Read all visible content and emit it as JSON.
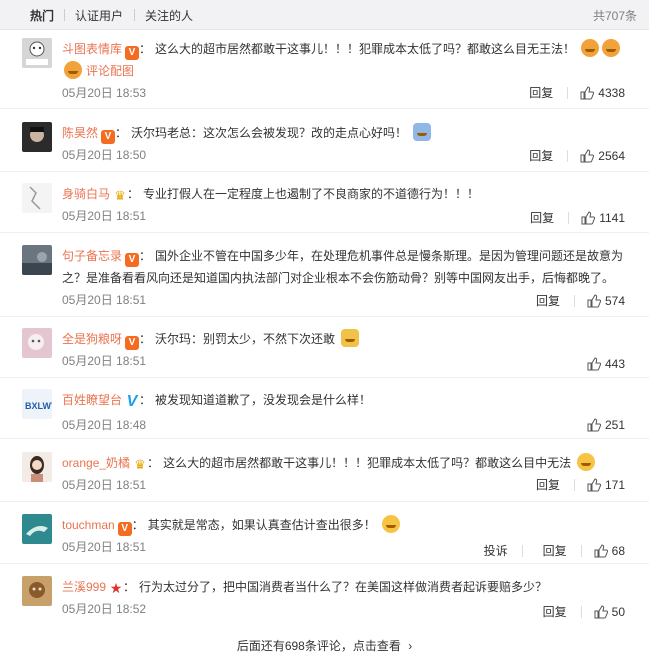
{
  "tabs": {
    "hot": "热门",
    "verified": "认证用户",
    "following": "关注的人",
    "total": "共707条"
  },
  "reply_label": "回复",
  "report_label": "投诉",
  "comments": [
    {
      "user": "斗图表情库",
      "badge": "V",
      "text": "这么大的超市居然都敢干这事儿！！！犯罪成本太低了吗？都敢这么目无王法！",
      "extra": "评论配图",
      "time": "05月20日 18:53",
      "likes": "4338",
      "avatar_color": "#bbbbbb"
    },
    {
      "user": "陈昊然",
      "badge": "V",
      "text": "沃尔玛老总：这次怎么会被发现？改的走点心好吗！",
      "time": "05月20日 18:50",
      "likes": "2564",
      "avatar_color": "#2b2b2b"
    },
    {
      "user": "身骑白马",
      "badge": "crown",
      "text": "专业打假人在一定程度上也遏制了不良商家的不道德行为！！！",
      "time": "05月20日 18:51",
      "likes": "1141",
      "avatar_color": "#e9e9e9"
    },
    {
      "user": "句子备忘录",
      "badge": "V",
      "text": "国外企业不管在中国多少年，在处理危机事件总是慢条斯理。是因为管理问题还是故意为之？是准备看看风向还是知道国内执法部门对企业根本不会伤筋动骨？别等中国网友出手，后悔都晚了。",
      "time": "05月20日 18:51",
      "likes": "574",
      "avatar_color": "#5a6470"
    },
    {
      "user": "全是狗粮呀",
      "badge": "V",
      "text": "沃尔玛：别罚太少，不然下次还敢",
      "time": "05月20日 18:51",
      "likes": "443",
      "avatar_color": "#d9a3b8"
    },
    {
      "user": "百姓瞭望台",
      "badge": "Vblue",
      "text": "被发现知道道歉了，没发现会是什么样！",
      "time": "05月20日 18:48",
      "likes": "251",
      "avatar_color": "#1f5fa8"
    },
    {
      "user": "orange_奶橘",
      "badge": "crown",
      "text": "这么大的超市居然都敢干这事儿！！！犯罪成本太低了吗？都敢这么目中无法",
      "time": "05月20日 18:51",
      "likes": "171",
      "avatar_color": "#e8d6c6"
    },
    {
      "user": "touchman",
      "badge": "V",
      "text": "其实就是常态，如果认真查估计查出很多！",
      "time": "05月20日 18:51",
      "likes": "68",
      "avatar_color": "#2e8a8e"
    },
    {
      "user": "兰溪999",
      "badge": "star",
      "text": "行为太过分了，把中国消费者当什么了？在美国这样做消费者起诉要赔多少？",
      "time": "05月20日 18:52",
      "likes": "50",
      "avatar_color": "#b07a3c"
    }
  ],
  "more_text": "后面还有698条评论，点击查看",
  "more_arrow": "›"
}
